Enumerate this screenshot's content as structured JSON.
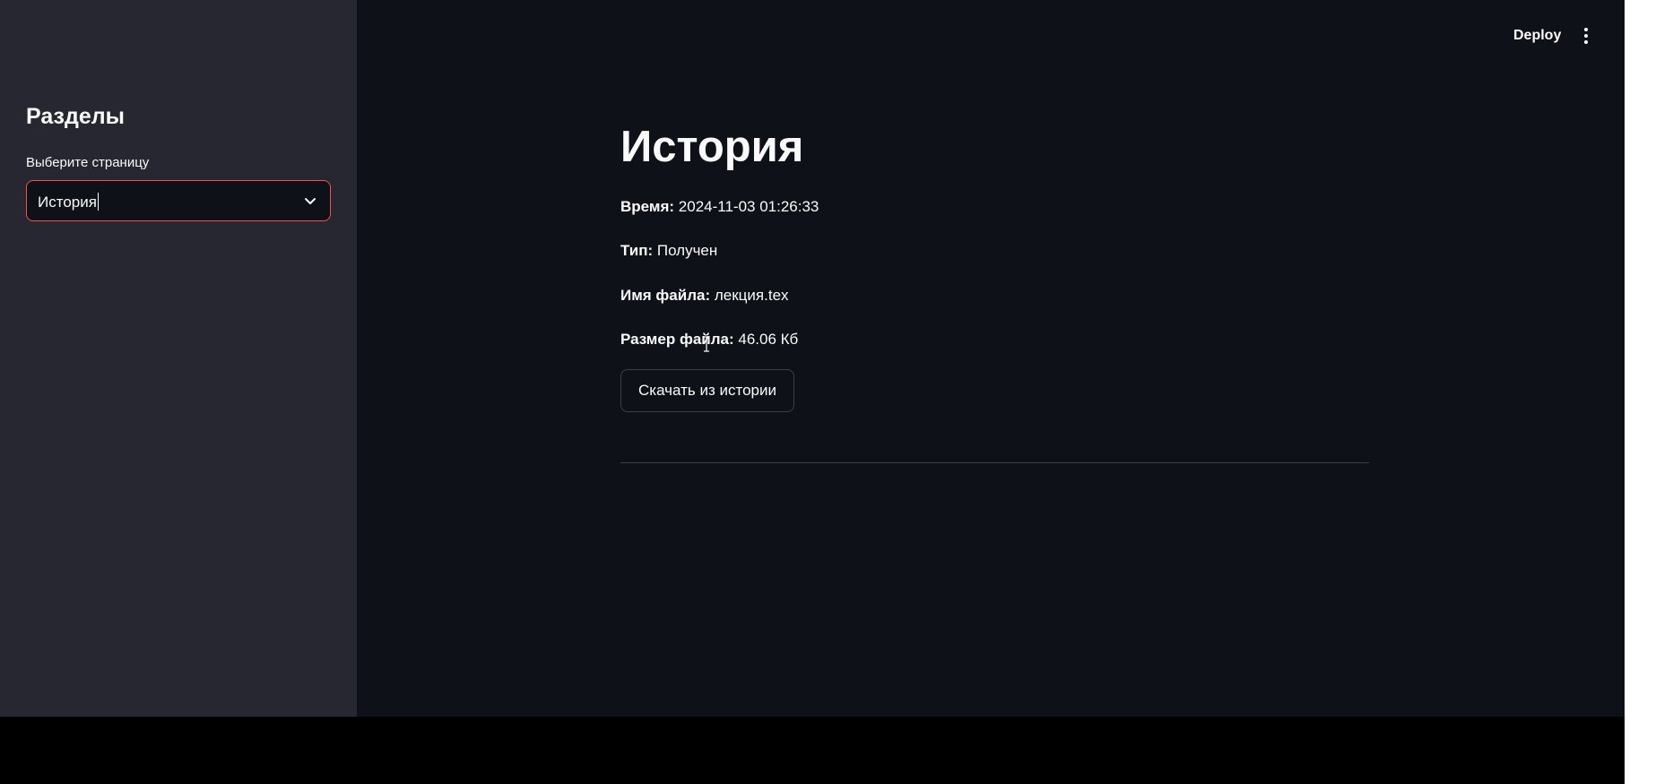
{
  "sidebar": {
    "title": "Разделы",
    "select_label": "Выберите страницу",
    "select_value": "История"
  },
  "header": {
    "deploy_label": "Deploy"
  },
  "main": {
    "title": "История",
    "rows": [
      {
        "label": "Время:",
        "value": "2024-11-03 01:26:33"
      },
      {
        "label": "Тип:",
        "value": "Получен"
      },
      {
        "label": "Имя файла:",
        "value": "лекция.tex"
      },
      {
        "label": "Размер файла:",
        "value": "46.06 Кб"
      }
    ],
    "download_label": "Скачать из истории"
  },
  "colors": {
    "background": "#0e1117",
    "sidebar": "#262730",
    "accent": "#ff4b4b"
  },
  "icons": [
    "chevron-down-icon",
    "more-vertical-icon",
    "text-cursor-icon"
  ]
}
